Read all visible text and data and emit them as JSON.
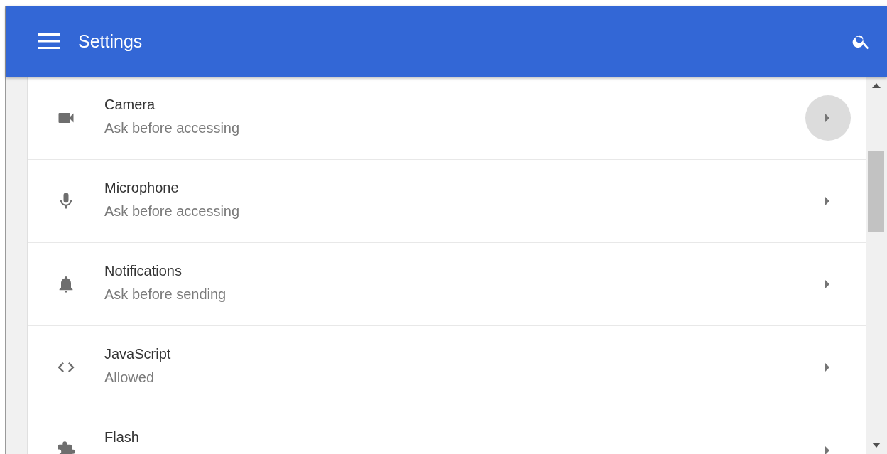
{
  "header": {
    "title": "Settings"
  },
  "items": [
    {
      "kind": "camera",
      "title": "Camera",
      "subtitle": "Ask before accessing",
      "highlighted": true
    },
    {
      "kind": "microphone",
      "title": "Microphone",
      "subtitle": "Ask before accessing",
      "highlighted": false
    },
    {
      "kind": "bell",
      "title": "Notifications",
      "subtitle": "Ask before sending",
      "highlighted": false
    },
    {
      "kind": "code",
      "title": "JavaScript",
      "subtitle": "Allowed",
      "highlighted": false
    },
    {
      "kind": "puzzle",
      "title": "Flash",
      "highlighted": false
    }
  ]
}
